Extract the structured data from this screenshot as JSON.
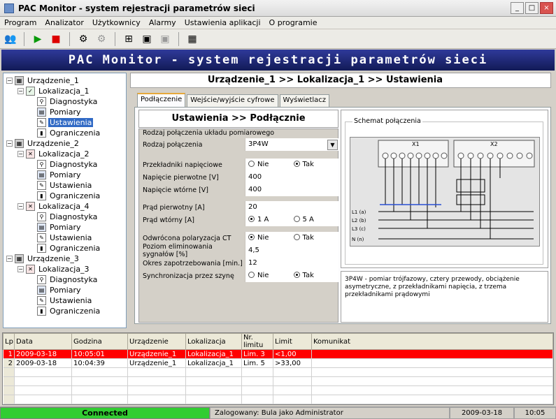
{
  "window": {
    "title": "PAC Monitor - system rejestracji parametrów sieci",
    "controls": [
      "_",
      "□",
      "×"
    ]
  },
  "menu": [
    "Program",
    "Analizator",
    "Użytkownicy",
    "Alarmy",
    "Ustawienia aplikacji",
    "O programie"
  ],
  "banner": "PAC Monitor - system rejestracji parametrów sieci",
  "breadcrumb": "Urządzenie_1 >> Lokalizacja_1 >> Ustawienia",
  "tree": {
    "dev1": "Urządzenie_1",
    "loc1": "Lokalizacja_1",
    "dev2": "Urządzenie_2",
    "loc2": "Lokalizacja_2",
    "loc4": "Lokalizacja_4",
    "dev3": "Urządzenie_3",
    "loc3": "Lokalizacja_3",
    "diag": "Diagnostyka",
    "pom": "Pomiary",
    "ust": "Ustawienia",
    "ogr": "Ograniczenia"
  },
  "tabs": [
    "Podłączenie",
    "Wejście/wyjście cyfrowe",
    "Wyświetlacz"
  ],
  "form": {
    "header": "Ustawienia >> Podłącznie",
    "section": "Rodzaj połączenia układu pomiarowego",
    "rodzaj_label": "Rodzaj połączenia",
    "rodzaj_value": "3P4W",
    "przekladniki_label": "Przekładniki napięciowe",
    "nie": "Nie",
    "tak": "Tak",
    "nap_pierw_label": "Napięcie pierwotne [V]",
    "nap_pierw_value": "400",
    "nap_wtor_label": "Napięcie wtórne [V]",
    "nap_wtor_value": "400",
    "prad_pierw_label": "Prąd pierwotny [A]",
    "prad_pierw_value": "20",
    "prad_wtor_label": "Prąd wtórny [A]",
    "prad_1a": "1 A",
    "prad_5a": "5 A",
    "odwrocona_label": "Odwrócona polaryzacja CT",
    "poziom_label": "Poziom eliminowania sygnałów [%]",
    "poziom_value": "4,5",
    "okres_label": "Okres zapotrzebowania [min.]",
    "okres_value": "12",
    "synchro_label": "Synchronizacja przez szynę"
  },
  "schematic": {
    "title": "Schemat połączenia",
    "description": "3P4W - pomiar trójfazowy, cztery przewody, obciążenie asymetryczne, z przekładnikami napięcia, z trzema przekładnikami prądowymi",
    "x1": "X1",
    "x2": "X2",
    "lines": [
      "L1 (a)",
      "L2 (b)",
      "L3 (c)",
      "N (n)"
    ]
  },
  "grid": {
    "columns": [
      "Lp",
      "Data",
      "Godzina",
      "Urządzenie",
      "Lokalizacja",
      "Nr. limitu",
      "Limit",
      "Komunikat"
    ],
    "rows": [
      [
        "1",
        "2009-03-18",
        "10:05:01",
        "Urządzenie_1",
        "Lokalizacja_1",
        "Lim. 3",
        "<1,00",
        ""
      ],
      [
        "2",
        "2009-03-18",
        "10:04:39",
        "Urządzenie_1",
        "Lokalizacja_1",
        "Lim. 5",
        ">33,00",
        ""
      ]
    ]
  },
  "status": {
    "connection": "Connected",
    "user": "Zalogowany: Bula jako Administrator",
    "date": "2009-03-18",
    "time": "10:05"
  },
  "colors": {
    "alarm_row": "#ff0000",
    "connected": "#32cd32",
    "banner": "#1e2a78",
    "selection": "#316ac5"
  }
}
